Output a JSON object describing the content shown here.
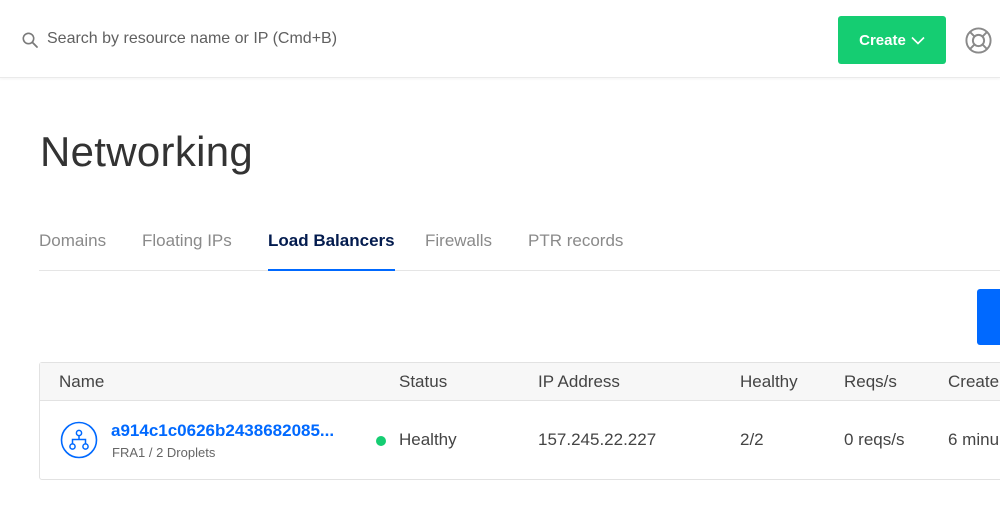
{
  "search": {
    "placeholder": "Search by resource name or IP (Cmd+B)",
    "value": ""
  },
  "header": {
    "create_label": "Create"
  },
  "page": {
    "title": "Networking"
  },
  "tabs": [
    {
      "label": "Domains",
      "active": false
    },
    {
      "label": "Floating IPs",
      "active": false
    },
    {
      "label": "Load Balancers",
      "active": true
    },
    {
      "label": "Firewalls",
      "active": false
    },
    {
      "label": "PTR records",
      "active": false
    }
  ],
  "table": {
    "columns": [
      "Name",
      "Status",
      "IP Address",
      "Healthy",
      "Reqs/s",
      "Create"
    ],
    "rows": [
      {
        "name": "a914c1c0626b2438682085...",
        "subtitle": "FRA1 / 2 Droplets",
        "status": "Healthy",
        "ip": "157.245.22.227",
        "healthy": "2/2",
        "reqs": "0 reqs/s",
        "created": "6 minu"
      }
    ]
  },
  "colors": {
    "accent": "#0069ff",
    "create_button": "#15cd72",
    "status_healthy": "#15cd72"
  },
  "icons": {
    "search": "search-icon",
    "create_chevron": "chevron-down-icon",
    "help": "lifebuoy-icon",
    "load_balancer": "load-balancer-icon"
  }
}
